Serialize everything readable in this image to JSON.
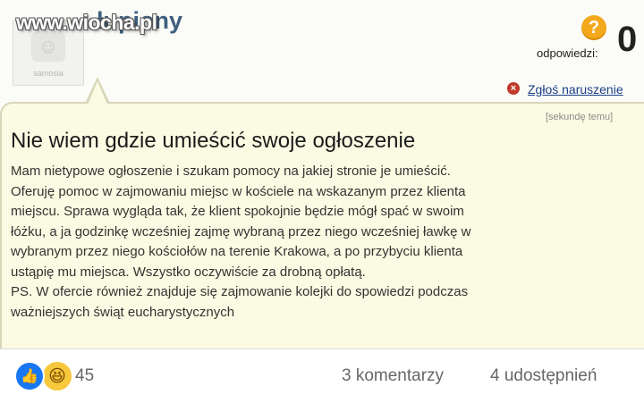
{
  "watermark": "www.wiocha.pl",
  "profile": {
    "avatar_caption": "samosia",
    "username": "łupiony"
  },
  "stats": {
    "question_icon": "question-mark-icon",
    "question_glyph": "?",
    "answers_label": "odpowiedzi:",
    "answers_count": "0"
  },
  "report": {
    "icon": "close-circle-icon",
    "label": "Zgłoś naruszenie"
  },
  "post": {
    "timestamp": "[sekundę temu]",
    "title": "Nie wiem gdzie umieścić swoje ogłoszenie",
    "lines": [
      "Mam nietypowe ogłoszenie i szukam pomocy na jakiej stronie je umieścić.",
      "Oferuję pomoc w zajmowaniu miejsc w kościele na wskazanym przez klienta",
      "miejscu. Sprawa wygląda tak, że klient spokojnie będzie mógł spać w swoim",
      "łóżku, a ja godzinkę wcześniej zajmę wybraną przez niego wcześniej ławkę w",
      "wybranym przez niego kościołów na terenie Krakowa, a po przybyciu klienta",
      "ustąpię mu miejsca. Wszystko oczywiście za drobną opłatą.",
      "PS. W ofercie również znajduje się zajmowanie kolejki do spowiedzi podczas",
      "ważniejszych świąt eucharystycznych"
    ]
  },
  "footer": {
    "like_icon": "like-icon",
    "haha_icon": "haha-icon",
    "reaction_count": "45",
    "comments": "3 komentarzy",
    "shares": "4 udostępnień"
  },
  "colors": {
    "bubble_bg": "#fbfbe3",
    "username": "#3f5f80",
    "link": "#1d3f8a",
    "like_blue": "#1877f2",
    "haha_yellow": "#f7c83b"
  }
}
